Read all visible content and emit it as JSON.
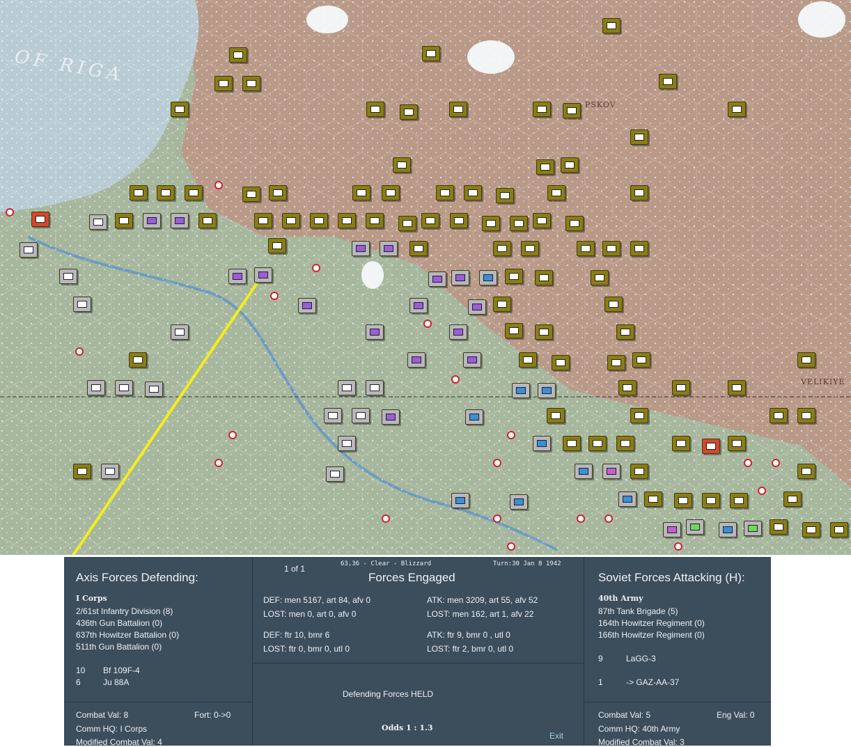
{
  "map": {
    "sea_label": "OF RIGA",
    "town_labels": [
      "PSKOV",
      "VELIKIYE"
    ],
    "colors": {
      "sea": "#b9ccd4",
      "land_green": "#a7b79e",
      "land_brown": "#b99a88",
      "axis_counter": "#8a7d16",
      "soviet_counter": "#b7b7bd",
      "arrow": "#f4ee1a",
      "badge": "#d02030"
    }
  },
  "combat": {
    "left": {
      "title": "Axis Forces Defending:",
      "corps": "I Corps",
      "units": [
        "2/61st Infantry Division (8)",
        "436th Gun Battalion (0)",
        "637th Howitzer Battalion (0)",
        "511th Gun Battalion (0)"
      ],
      "air": [
        {
          "count": "10",
          "name": "Bf 109F-4"
        },
        {
          "count": "6",
          "name": "Ju 88A"
        }
      ],
      "combat_val": "Combat Val: 8",
      "fort": "Fort: 0->0",
      "comm_hq": "Comm HQ: I Corps",
      "modified": "Modified Combat Val: 4"
    },
    "middle": {
      "location": "63,36 - Clear - Blizzard",
      "turn": "Turn:30  Jan 8 1942",
      "page": "1 of 1",
      "title": "Forces Engaged",
      "def_men": "DEF: men 5167, art 84, afv 0",
      "def_lost": "LOST: men 0, art 0, afv 0",
      "atk_men": "ATK: men 3209, art 55, afv 52",
      "atk_lost": "LOST: men 162, art 1, afv 22",
      "def_air": "DEF: ftr 10, bmr 6",
      "def_air_lost": "LOST: ftr 0, bmr 0, utl 0",
      "atk_air": "ATK: ftr 9, bmr 0 , utl 0",
      "atk_air_lost": "LOST: ftr 2, bmr 0, utl 0",
      "result": "Defending Forces HELD",
      "odds": "Odds 1 : 1.3",
      "exit": "Exit"
    },
    "right": {
      "title": "Soviet Forces Attacking (H):",
      "army": "40th Army",
      "units": [
        "87th Tank Brigade (5)",
        "164th Howitzer Regiment (0)",
        "166th Howitzer Regiment (0)"
      ],
      "air": [
        {
          "count": "9",
          "name": "LaGG-3"
        },
        {
          "count": "1",
          "name": "-> GAZ-AA-37"
        }
      ],
      "combat_val": "Combat Val: 5",
      "eng": "Eng Val: 0",
      "comm_hq": "Comm HQ: 40th Army",
      "modified": "Modified Combat Val: 3"
    }
  }
}
